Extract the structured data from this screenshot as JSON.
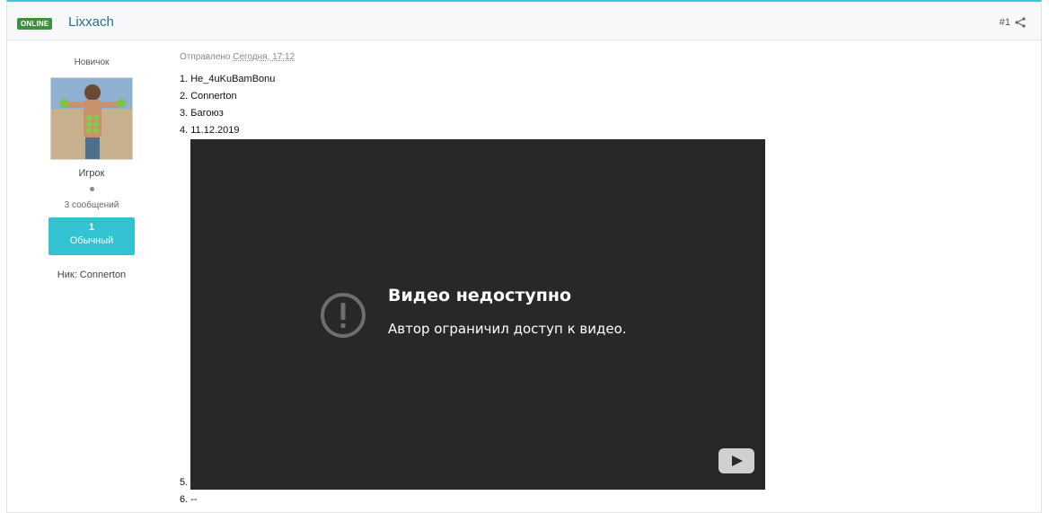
{
  "header": {
    "badge": "ONLINE",
    "author": "Lixxach",
    "post_number": "#1"
  },
  "sidebar": {
    "rank_title": "Новичок",
    "group": "Игрок",
    "post_count": "3 сообщений",
    "reputation_value": "1",
    "reputation_label": "Обычный",
    "nick": "Ник: Connerton"
  },
  "post": {
    "date_prefix": "Отправлено",
    "date_time": "Сегодня, 17:12",
    "lines": [
      "1. He_4uKuBamBonu",
      "2. Connerton",
      "3. Багоюз",
      "4. 11.12.2019"
    ],
    "video_line_number": "5.",
    "last_line": "6. --"
  },
  "video": {
    "title": "Видео недоступно",
    "subtitle": "Автор ограничил доступ к видео."
  },
  "colors": {
    "accent": "#33c2d2",
    "online_badge": "#3f8f3f",
    "author_link": "#2b6f8f",
    "video_bg": "#282828"
  }
}
